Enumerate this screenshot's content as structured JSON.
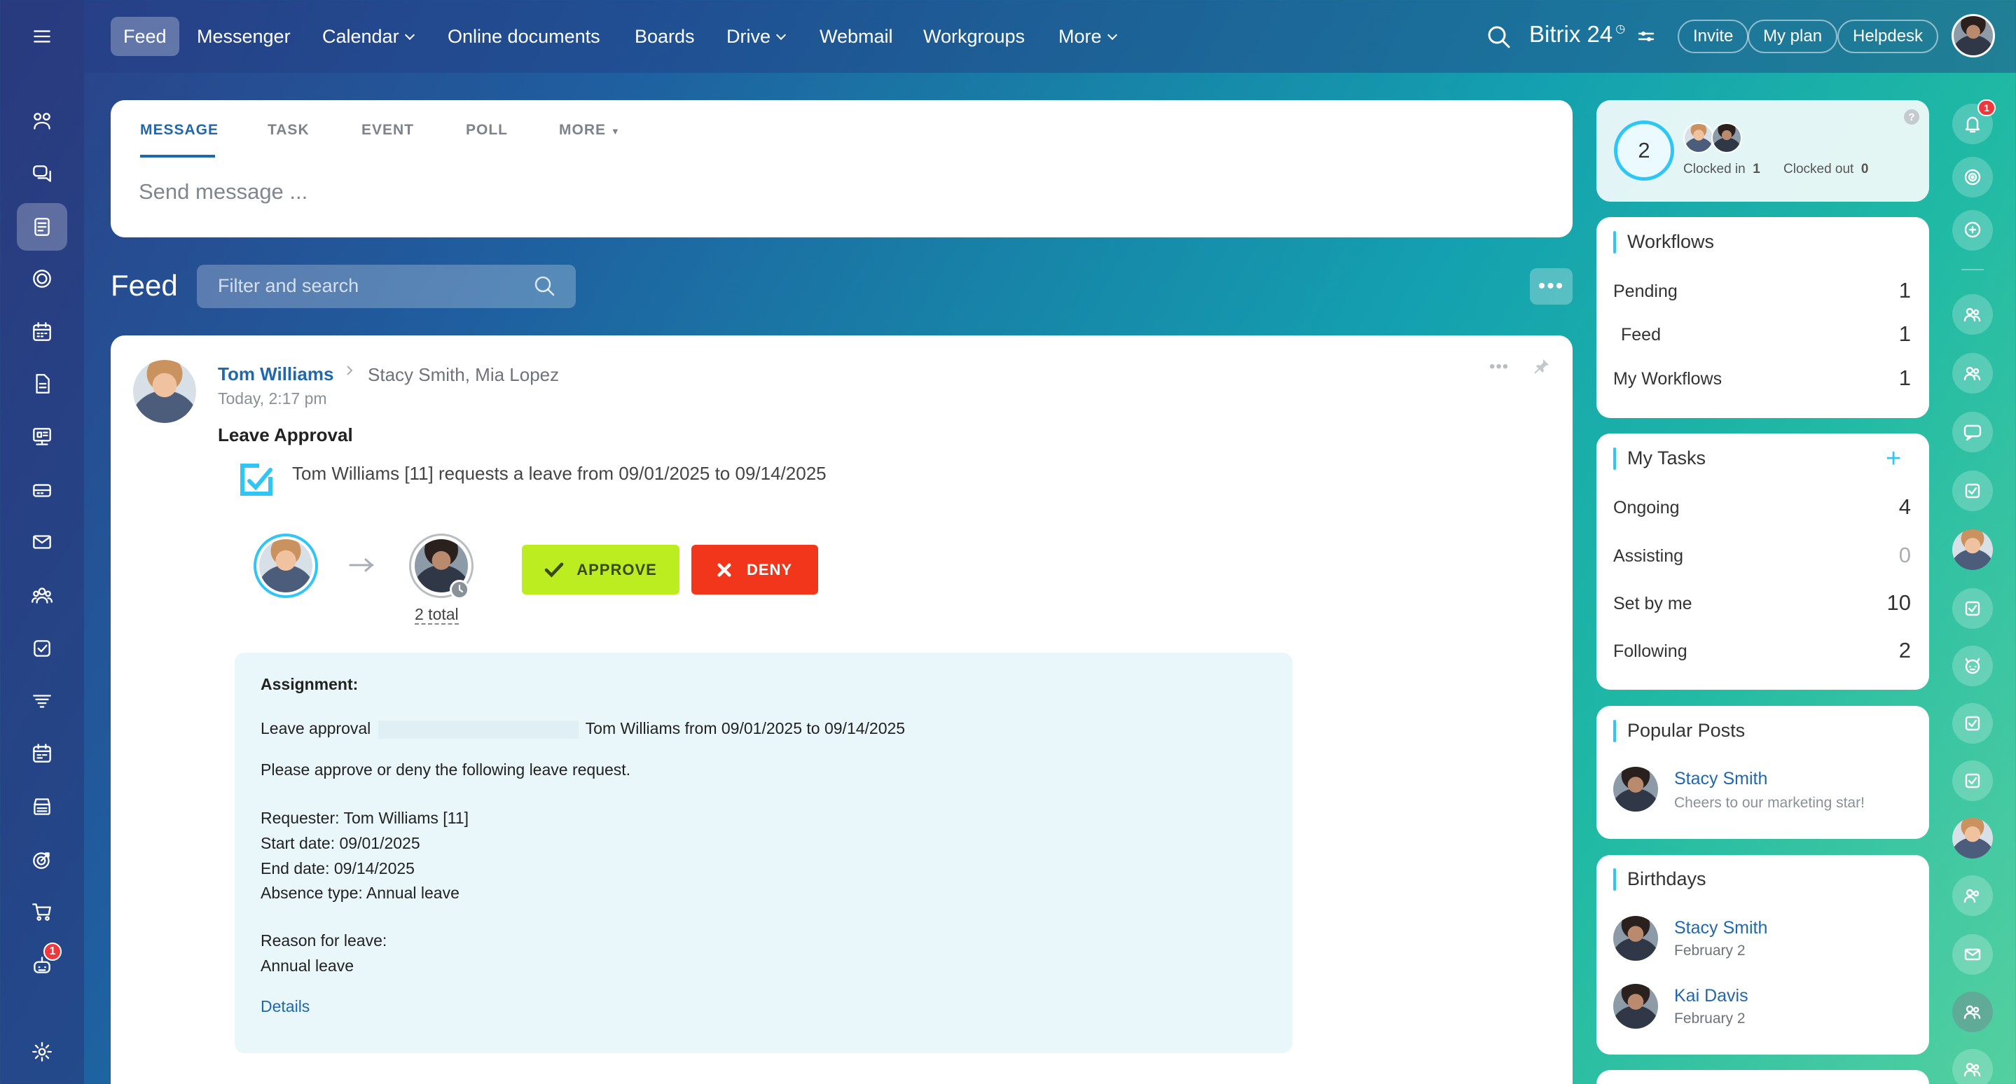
{
  "topbar": {
    "nav": [
      {
        "label": "Feed",
        "active": true,
        "dropdown": false
      },
      {
        "label": "Messenger",
        "active": false,
        "dropdown": false
      },
      {
        "label": "Calendar",
        "active": false,
        "dropdown": true
      },
      {
        "label": "Online documents",
        "active": false,
        "dropdown": false
      },
      {
        "label": "Boards",
        "active": false,
        "dropdown": false
      },
      {
        "label": "Drive",
        "active": false,
        "dropdown": true
      },
      {
        "label": "Webmail",
        "active": false,
        "dropdown": false
      },
      {
        "label": "Workgroups",
        "active": false,
        "dropdown": false
      },
      {
        "label": "More",
        "active": false,
        "dropdown": true
      }
    ],
    "brand": "Bitrix 24",
    "invite": "Invite",
    "my_plan": "My plan",
    "helpdesk": "Helpdesk"
  },
  "sidebar": {
    "icons": [
      "menu-icon",
      "collab-icon",
      "chat-icon",
      "feed-icon",
      "tasks-circle-icon",
      "calendar-icon",
      "document-icon",
      "presentation-icon",
      "inbox-icon",
      "mail-icon",
      "team-icon",
      "checkbox-icon",
      "filter-icon",
      "schedule-icon",
      "store-icon",
      "target-icon",
      "cart-icon",
      "bot-icon",
      "settings-icon"
    ],
    "bot_badge": "1"
  },
  "composer": {
    "tabs": [
      "MESSAGE",
      "TASK",
      "EVENT",
      "POLL",
      "MORE"
    ],
    "active_tab": "MESSAGE",
    "placeholder": "Send message ..."
  },
  "feed": {
    "title": "Feed",
    "search_placeholder": "Filter and search"
  },
  "post": {
    "author": "Tom Williams",
    "recipients": "Stacy Smith, Mia Lopez",
    "time": "Today, 2:17 pm",
    "title": "Leave Approval",
    "request_text": "Tom Williams [11] requests a leave from 09/01/2025 to 09/14/2025",
    "approvers_total": "2 total",
    "approve_label": "APPROVE",
    "deny_label": "DENY",
    "assignment": {
      "heading": "Assignment:",
      "line1_prefix": "Leave approval",
      "line1_suffix": "Tom Williams from 09/01/2025 to 09/14/2025",
      "line2": "Please approve or deny the following leave request.",
      "requester": "Requester: Tom Williams [11]",
      "start": "Start date: 09/01/2025",
      "end": "End date: 09/14/2025",
      "absence": "Absence type: Annual leave",
      "reason_label": "Reason for leave:",
      "reason": "Annual leave",
      "details": "Details"
    }
  },
  "timeman": {
    "count": "2",
    "clocked_in_label": "Clocked in",
    "clocked_in": "1",
    "clocked_out_label": "Clocked out",
    "clocked_out": "0"
  },
  "workflows": {
    "title": "Workflows",
    "rows": [
      {
        "label": "Pending",
        "value": "1"
      },
      {
        "label": "Feed",
        "value": "1"
      },
      {
        "label": "My Workflows",
        "value": "1"
      }
    ]
  },
  "my_tasks": {
    "title": "My Tasks",
    "rows": [
      {
        "label": "Ongoing",
        "value": "4"
      },
      {
        "label": "Assisting",
        "value": "0"
      },
      {
        "label": "Set by me",
        "value": "10"
      },
      {
        "label": "Following",
        "value": "2"
      }
    ]
  },
  "popular_posts": {
    "title": "Popular Posts",
    "items": [
      {
        "name": "Stacy Smith",
        "text": "Cheers to our marketing star!"
      }
    ]
  },
  "birthdays": {
    "title": "Birthdays",
    "items": [
      {
        "name": "Stacy Smith",
        "date": "February 2"
      },
      {
        "name": "Kai Davis",
        "date": "February 2"
      }
    ]
  },
  "right_rail": {
    "notification_badge": "1"
  },
  "colors": {
    "accent": "#2067b0",
    "approve": "#bbed21",
    "deny": "#f2361b",
    "assignment_bg": "#e9f7fb"
  }
}
